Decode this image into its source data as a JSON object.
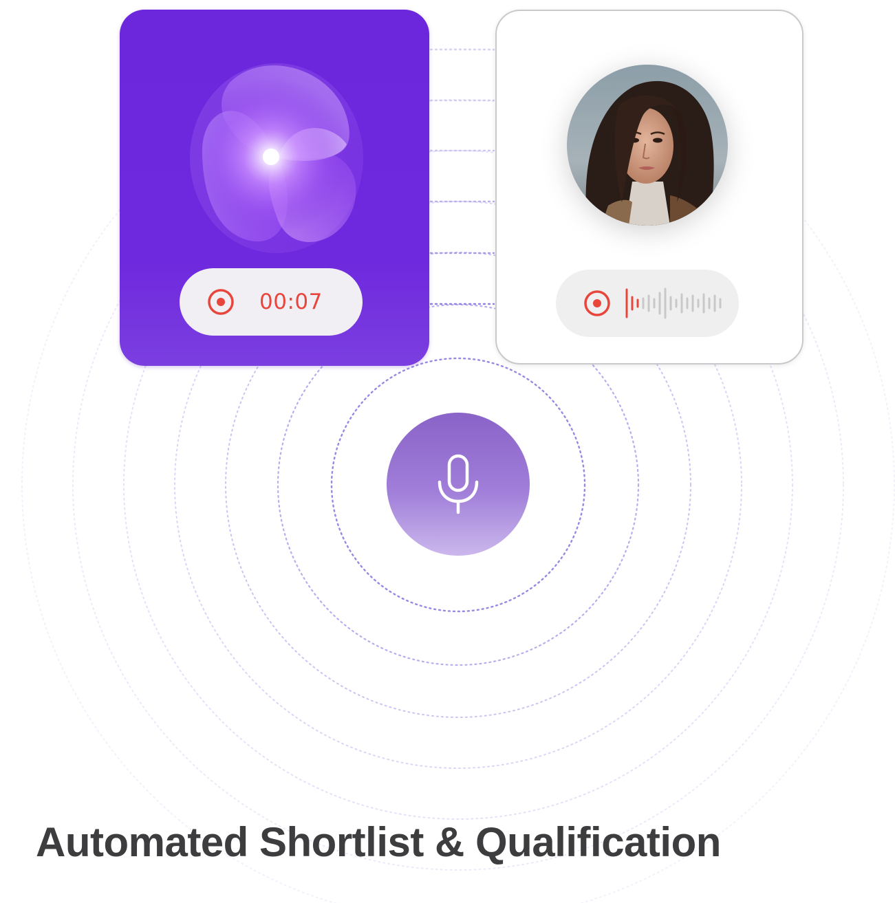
{
  "ai_card": {
    "timer_text": "00:07"
  },
  "candidate_card": {
    "avatar_label": "candidate-portrait"
  },
  "mic": {
    "icon": "microphone-icon"
  },
  "heading": {
    "title": "Automated Shortlist & Qualification"
  },
  "colors": {
    "brand_purple": "#6c26dc",
    "record_red": "#e8453c",
    "ring_purple": "#9c8ee6",
    "heading_text": "#3d3d3f"
  },
  "icons": {
    "record": "record-icon",
    "waveform": "waveform-icon",
    "mic": "microphone-icon"
  }
}
